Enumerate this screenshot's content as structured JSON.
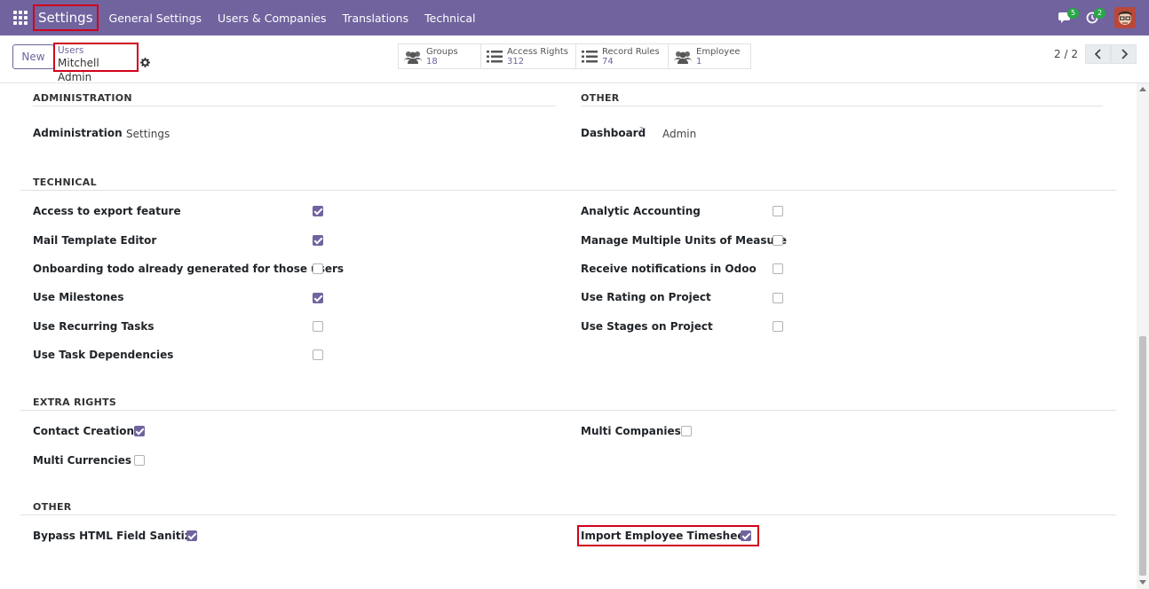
{
  "topbar": {
    "app_name": "Settings",
    "menu": [
      "General Settings",
      "Users & Companies",
      "Translations",
      "Technical"
    ],
    "messages_count": "5",
    "activities_count": "2"
  },
  "control": {
    "new_label": "New",
    "breadcrumb_parent": "Users",
    "breadcrumb_current": "Mitchell Admin",
    "smart_buttons": [
      {
        "label": "Groups",
        "value": "18",
        "icon": "users-icon"
      },
      {
        "label": "Access Rights",
        "value": "312",
        "icon": "list-icon"
      },
      {
        "label": "Record Rules",
        "value": "74",
        "icon": "list-icon"
      },
      {
        "label": "Employee",
        "value": "1",
        "icon": "users-icon"
      }
    ],
    "pager": "2 / 2"
  },
  "sections": {
    "administration": {
      "title": "ADMINISTRATION",
      "field_label": "Administration",
      "field_value": "Settings"
    },
    "other_top": {
      "title": "OTHER",
      "field_label": "Dashboard",
      "tooltip": "?",
      "field_value": "Admin"
    },
    "technical": {
      "title": "TECHNICAL",
      "left": [
        {
          "label": "Access to export feature",
          "checked": true
        },
        {
          "label": "Mail Template Editor",
          "checked": true
        },
        {
          "label": "Onboarding todo already generated for those users",
          "checked": false
        },
        {
          "label": "Use Milestones",
          "checked": true
        },
        {
          "label": "Use Recurring Tasks",
          "checked": false
        },
        {
          "label": "Use Task Dependencies",
          "checked": false
        }
      ],
      "right": [
        {
          "label": "Analytic Accounting",
          "checked": false
        },
        {
          "label": "Manage Multiple Units of Measure",
          "checked": false
        },
        {
          "label": "Receive notifications in Odoo",
          "checked": false
        },
        {
          "label": "Use Rating on Project",
          "checked": false
        },
        {
          "label": "Use Stages on Project",
          "checked": false
        }
      ]
    },
    "extra_rights": {
      "title": "EXTRA RIGHTS",
      "left": [
        {
          "label": "Contact Creation",
          "checked": true
        },
        {
          "label": "Multi Currencies",
          "checked": false
        }
      ],
      "right": [
        {
          "label": "Multi Companies",
          "checked": false
        }
      ]
    },
    "other_bottom": {
      "title": "OTHER",
      "left": [
        {
          "label": "Bypass HTML Field Sanitize",
          "checked": true
        }
      ],
      "right": [
        {
          "label": "Import Employee Timesheet",
          "checked": true
        }
      ]
    }
  },
  "colors": {
    "brand": "#71639e",
    "highlight": "#d0021b"
  }
}
